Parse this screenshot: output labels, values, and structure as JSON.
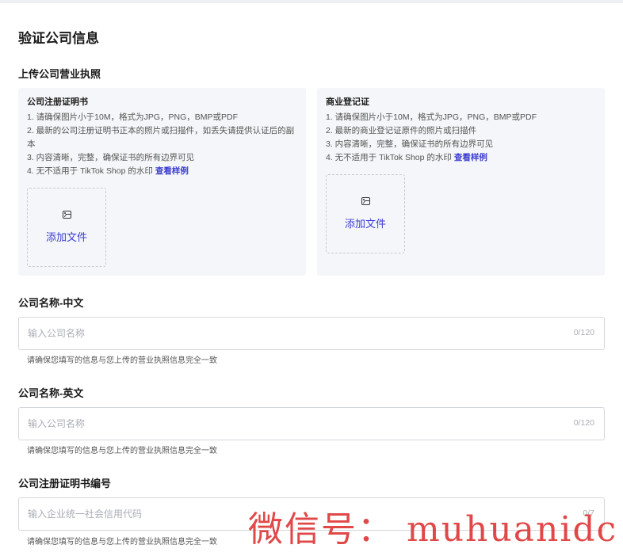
{
  "page": {
    "title": "验证公司信息",
    "upload_section_title": "上传公司营业执照"
  },
  "cards": [
    {
      "title": "公司注册证明书",
      "requirements": [
        "1. 请确保图片小于10M，格式为JPG，PNG，BMP或PDF",
        "2. 最新的公司注册证明书正本的照片或扫描件，如丢失请提供认证后的副本",
        "3. 内容清晰，完整，确保证书的所有边界可见",
        "4. 无不适用于 TikTok Shop 的水印"
      ],
      "example_link": "查看样例",
      "upload_label": "添加文件",
      "upload_icon": "image-icon"
    },
    {
      "title": "商业登记证",
      "requirements": [
        "1. 请确保图片小于10M，格式为JPG，PNG，BMP或PDF",
        "2. 最新的商业登记证原件的照片或扫描件",
        "3. 内容清晰，完整，确保证书的所有边界可见",
        "4. 无不适用于 TikTok Shop 的水印"
      ],
      "example_link": "查看样例",
      "upload_label": "添加文件",
      "upload_icon": "image-icon"
    }
  ],
  "fields": [
    {
      "label": "公司名称-中文",
      "placeholder": "输入公司名称",
      "value": "",
      "counter": "0/120",
      "hint": "请确保您填写的信息与您上传的营业执照信息完全一致"
    },
    {
      "label": "公司名称-英文",
      "placeholder": "输入公司名称",
      "value": "",
      "counter": "0/120",
      "hint": "请确保您填写的信息与您上传的营业执照信息完全一致"
    },
    {
      "label": "公司注册证明书编号",
      "placeholder": "输入企业统一社会信用代码",
      "value": "",
      "counter": "0/7",
      "hint": "请确保您填写的信息与您上传的营业执照信息完全一致"
    }
  ],
  "watermark": "微信号： muhuanidc",
  "colors": {
    "accent": "#3b3bd1",
    "card_bg": "#f5f6f9",
    "watermark": "#dc2828"
  }
}
